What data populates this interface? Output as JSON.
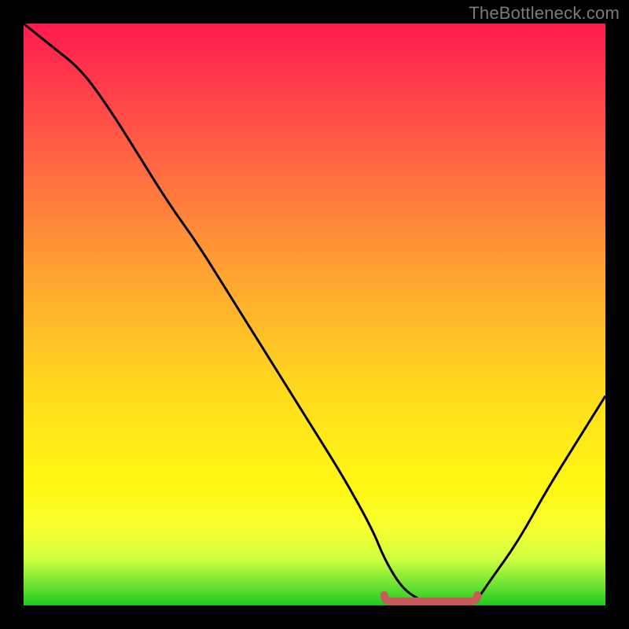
{
  "watermark": "TheBottleneck.com",
  "colors": {
    "frame": "#000000",
    "curve": "#000000",
    "marker": "#c85a5a",
    "gradient_top": "#ff1a4d",
    "gradient_bottom": "#20c820"
  },
  "chart_data": {
    "type": "line",
    "title": "",
    "xlabel": "",
    "ylabel": "",
    "xlim": [
      0,
      100
    ],
    "ylim": [
      0,
      100
    ],
    "grid": false,
    "x": [
      0,
      5,
      10,
      15,
      20,
      25,
      30,
      35,
      40,
      45,
      50,
      55,
      60,
      62,
      65,
      68,
      70,
      72,
      75,
      78,
      80,
      85,
      90,
      95,
      100
    ],
    "values": [
      100,
      96,
      92,
      85,
      77,
      69,
      62,
      54,
      46,
      38,
      30,
      22,
      13,
      8,
      3,
      1,
      0,
      0,
      0,
      1,
      4,
      11,
      20,
      28,
      36
    ],
    "annotations": [
      {
        "type": "segment_marker",
        "description": "flat minimum region highlighted in pink/red",
        "x_start": 62,
        "x_end": 78,
        "y": 0
      }
    ]
  }
}
